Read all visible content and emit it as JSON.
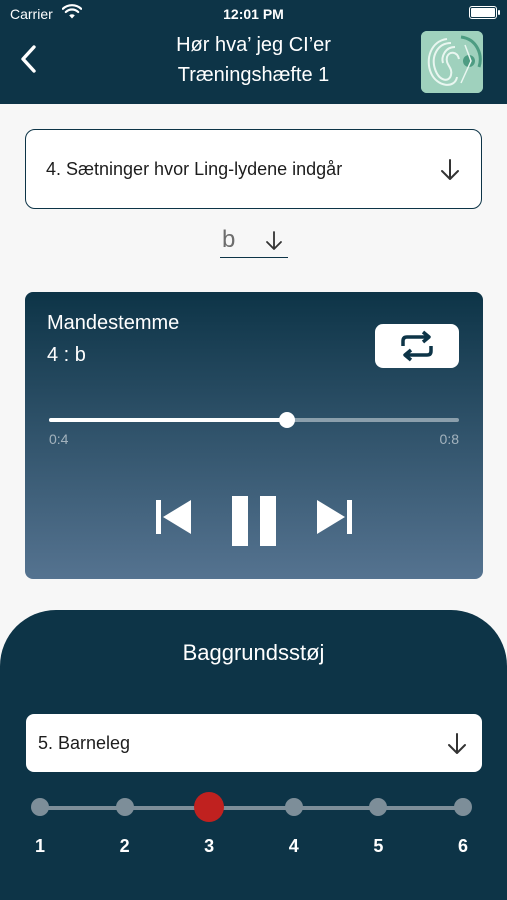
{
  "status_bar": {
    "carrier": "Carrier",
    "time": "12:01 PM"
  },
  "header": {
    "title_line1": "Hør hva’ jeg CI’er",
    "title_line2": "Træningshæfte 1",
    "icons": {
      "back": "chevron-left-icon",
      "logo": "ear-logo"
    }
  },
  "exercise_select": {
    "value": "4. Sætninger hvor Ling-lydene indgår"
  },
  "letter_select": {
    "value": "b"
  },
  "player": {
    "voice": "Mandestemme",
    "track": "4 : b",
    "progress": 0.58,
    "time_start": "0:4",
    "time_end": "0:8",
    "icons": {
      "repeat": "repeat-icon",
      "previous": "skip-previous-icon",
      "pause": "pause-icon",
      "next": "skip-next-icon"
    }
  },
  "background_noise": {
    "heading": "Baggrundsstøj",
    "select_value": "5. Barneleg",
    "levels": [
      "1",
      "2",
      "3",
      "4",
      "5",
      "6"
    ],
    "selected_level": 3
  },
  "colors": {
    "primary": "#0d3447",
    "accent": "#c0211f",
    "background": "#f7f7f7"
  }
}
